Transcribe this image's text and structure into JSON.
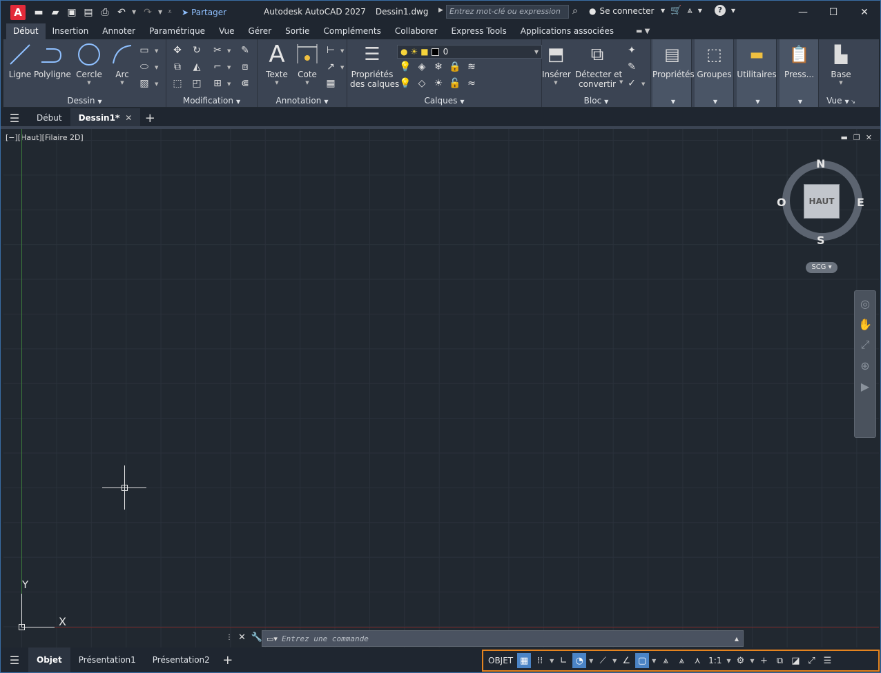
{
  "titlebar": {
    "logo": "A",
    "share_label": "Partager",
    "app_name": "Autodesk AutoCAD 2027",
    "file_name": "Dessin1.dwg",
    "search_placeholder": "Entrez mot-clé ou expression",
    "signin_label": "Se connecter"
  },
  "ribbon_tabs": [
    "Début",
    "Insertion",
    "Annoter",
    "Paramétrique",
    "Vue",
    "Gérer",
    "Sortie",
    "Compléments",
    "Collaborer",
    "Express Tools",
    "Applications associées"
  ],
  "ribbon": {
    "dessin": {
      "title": "Dessin",
      "ligne": "Ligne",
      "polyligne": "Polyligne",
      "cercle": "Cercle",
      "arc": "Arc"
    },
    "modification": {
      "title": "Modification"
    },
    "annotation": {
      "title": "Annotation",
      "texte": "Texte",
      "cote": "Cote"
    },
    "calques": {
      "title": "Calques",
      "props_line1": "Propriétés",
      "props_line2": "des calques",
      "current_layer": "0"
    },
    "bloc": {
      "title": "Bloc",
      "inserer": "Insérer",
      "detect_line1": "Détecter et",
      "detect_line2": "convertir"
    },
    "proprietes": "Propriétés",
    "groupes": "Groupes",
    "utilitaires": "Utilitaires",
    "presse": "Press...",
    "vue": {
      "base": "Base",
      "title": "Vue"
    }
  },
  "file_tabs": {
    "start": "Début",
    "drawing": "Dessin1*"
  },
  "viewport": {
    "label": "[−][Haut][Filaire 2D]",
    "ucs_x": "X",
    "ucs_y": "Y",
    "viewcube": {
      "face": "HAUT",
      "north": "N",
      "south": "S",
      "east": "E",
      "west": "O",
      "ucs_menu": "SCG"
    }
  },
  "command": {
    "placeholder": "Entrez une commande"
  },
  "layout_tabs": [
    "Objet",
    "Présentation1",
    "Présentation2"
  ],
  "status": {
    "model": "OBJET",
    "scale": "1:1"
  },
  "colors": {
    "accent": "#4b84c6",
    "highlight": "#e5841f",
    "logo": "#e32b3a",
    "ribbon": "#3b4453"
  }
}
